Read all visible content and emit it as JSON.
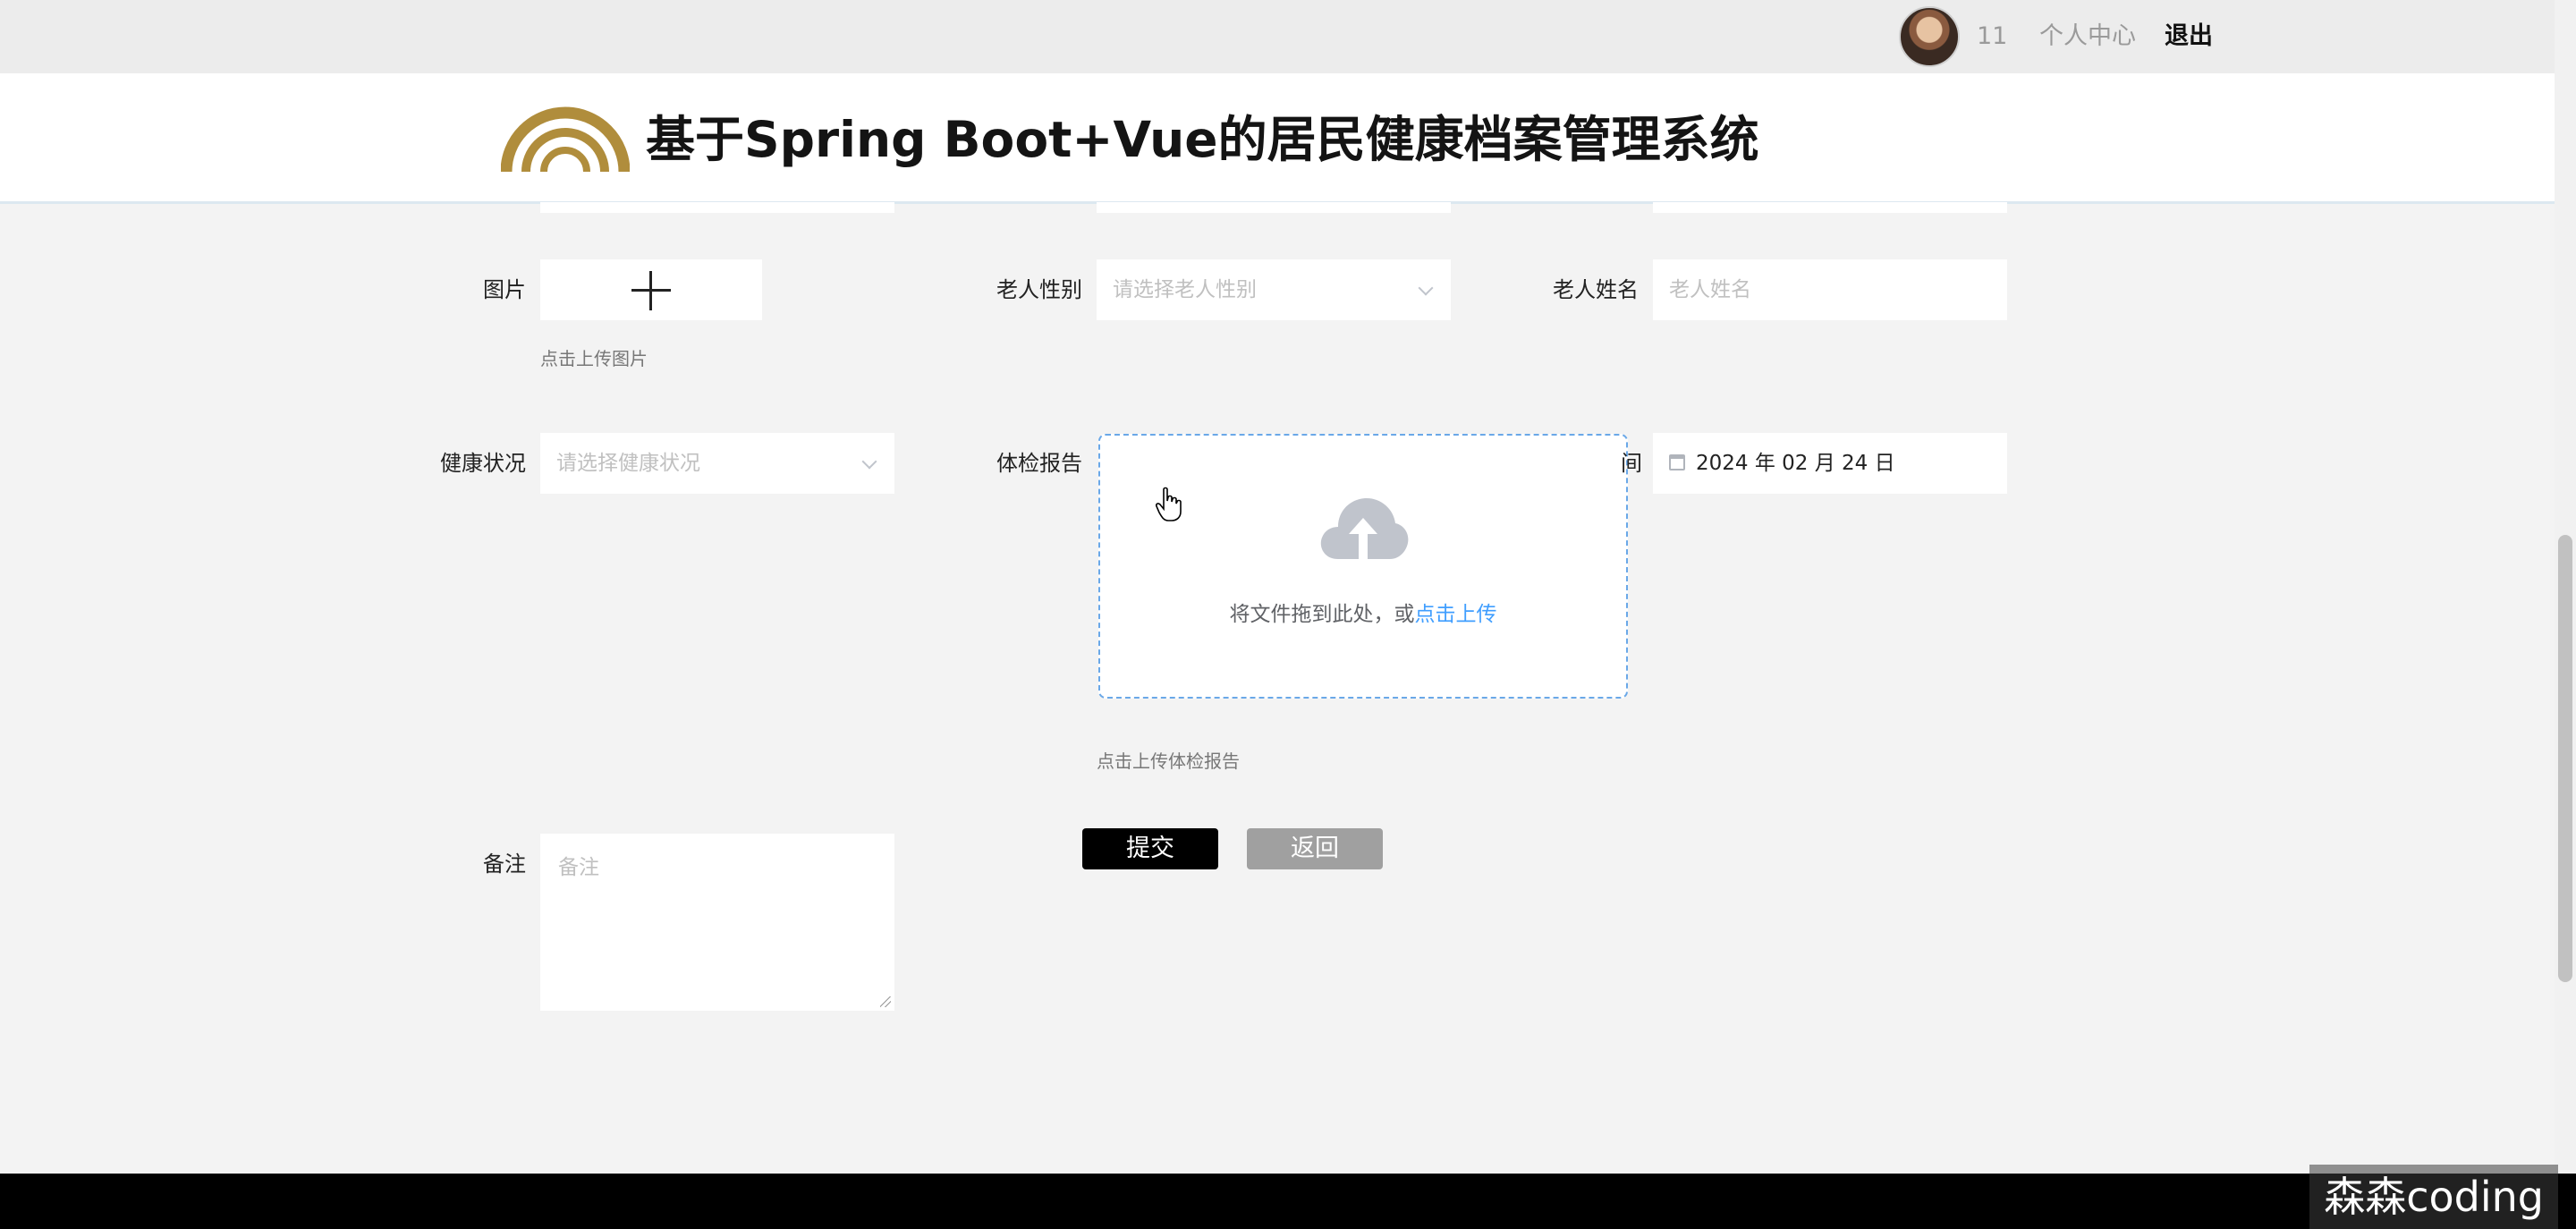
{
  "topbar": {
    "user_number": "11",
    "profile_link": "个人中心",
    "logout_link": "退出"
  },
  "header": {
    "title": "基于Spring Boot+Vue的居民健康档案管理系统"
  },
  "form": {
    "image": {
      "label": "图片",
      "hint": "点击上传图片"
    },
    "gender": {
      "label": "老人性别",
      "placeholder": "请选择老人性别"
    },
    "name": {
      "label": "老人姓名",
      "placeholder": "老人姓名"
    },
    "health": {
      "label": "健康状况",
      "placeholder": "请选择健康状况"
    },
    "report": {
      "label": "体检报告",
      "drag_text": "将文件拖到此处，或",
      "drag_link": "点击上传",
      "hint": "点击上传体检报告"
    },
    "date": {
      "label_partial": "间",
      "value": "2024 年 02 月 24 日"
    },
    "notes": {
      "label": "备注",
      "placeholder": "备注"
    },
    "buttons": {
      "submit": "提交",
      "back": "返回"
    }
  },
  "watermark": "森森coding",
  "colors": {
    "accent": "#409eff",
    "logo_gold": "#b08d3c",
    "submit_bg": "#000000",
    "back_bg": "#a0a0a0"
  },
  "icons": {
    "upload_cloud": "cloud-upload-icon",
    "calendar": "calendar-icon",
    "plus": "plus-icon",
    "chevron": "chevron-down-icon"
  }
}
